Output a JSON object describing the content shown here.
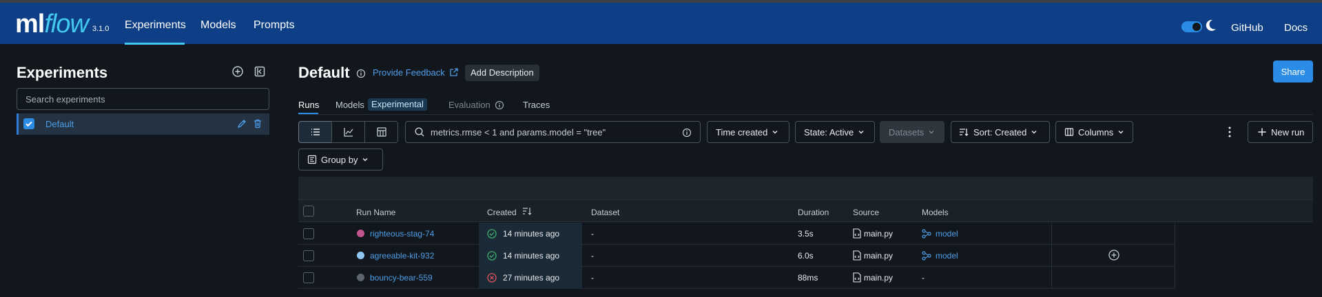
{
  "header": {
    "logo_prefix": "ml",
    "logo_suffix": "flow",
    "version": "3.1.0",
    "nav": [
      "Experiments",
      "Models",
      "Prompts"
    ],
    "links": [
      "GitHub",
      "Docs"
    ]
  },
  "sidebar": {
    "title": "Experiments",
    "search_placeholder": "Search experiments",
    "items": [
      {
        "label": "Default"
      }
    ]
  },
  "main": {
    "title": "Default",
    "feedback_link": "Provide Feedback",
    "add_description": "Add Description",
    "share": "Share",
    "tabs": [
      "Runs",
      "Models",
      "Evaluation",
      "Traces"
    ],
    "models_badge": "Experimental",
    "search_placeholder": "metrics.rmse < 1 and params.model = \"tree\"",
    "filters": {
      "time": "Time created",
      "state": "State: Active",
      "datasets": "Datasets",
      "sort": "Sort: Created",
      "columns": "Columns",
      "new_run": "New run",
      "group_by": "Group by"
    }
  },
  "table": {
    "columns": [
      "Run Name",
      "Created",
      "Dataset",
      "Duration",
      "Source",
      "Models"
    ],
    "rows": [
      {
        "name": "righteous-stag-74",
        "created": "14 minutes ago",
        "dataset": "-",
        "duration": "3.5s",
        "source": "main.py",
        "model": "model",
        "status": "success",
        "color": "#c2548d"
      },
      {
        "name": "agreeable-kit-932",
        "created": "14 minutes ago",
        "dataset": "-",
        "duration": "6.0s",
        "source": "main.py",
        "model": "model",
        "status": "success",
        "color": "#8fc7f0"
      },
      {
        "name": "bouncy-bear-559",
        "created": "27 minutes ago",
        "dataset": "-",
        "duration": "88ms",
        "source": "main.py",
        "model": "-",
        "status": "failed",
        "color": "#5d6670"
      }
    ]
  },
  "colors": {
    "header_bg": "#0e3f86",
    "accent": "#2b8ce6",
    "link": "#4f9de8",
    "success": "#3cae6c",
    "failed": "#e0575f"
  }
}
